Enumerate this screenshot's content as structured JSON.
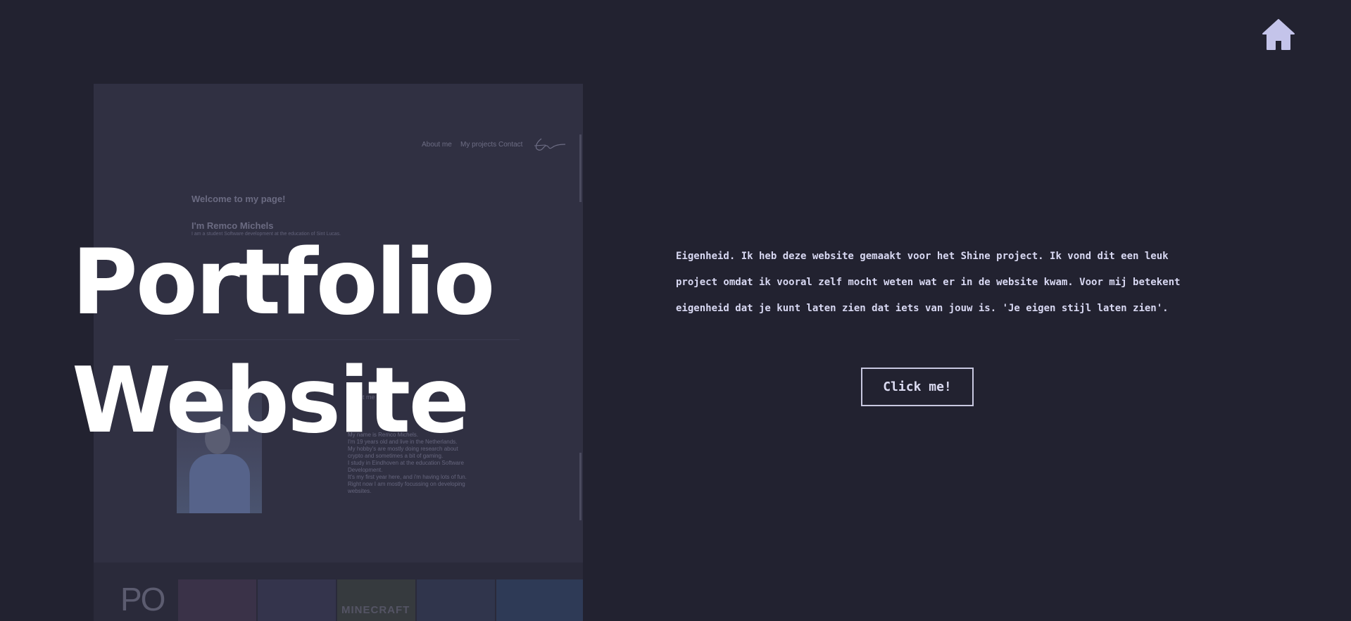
{
  "header": {
    "home_icon": "home-icon",
    "home_color": "#c4c4ea"
  },
  "hero": {
    "title_line1": "Portfolio",
    "title_line2": "Website"
  },
  "preview": {
    "nav_about": "About me",
    "nav_projects": "My projects",
    "nav_contact": "Contact",
    "welcome": "Welcome to my page!",
    "name": "I'm Remco Michels",
    "subtitle": "I am a student Software development at the education of Sint Lucas.",
    "about_title": "About me",
    "about_lines": [
      "My name is Remco Michels.",
      "I'm 19 years old and live in the Netherlands.",
      "My hobby's are mostly doing research about",
      "crypto and sometimes a bit of gaming.",
      "I study in Eindhoven at the education Software",
      "Development.",
      "It's my first year here, and i'm having lots of fun.",
      "Right now I am mostly focussing on developing",
      "websites."
    ],
    "logo": "PO",
    "tile_label": "MINECRAFT"
  },
  "content": {
    "description": "Eigenheid. Ik heb deze website gemaakt voor het Shine project. Ik vond dit een leuk project omdat ik vooral zelf mocht weten wat er in de website kwam. Voor mij betekent eigenheid dat je kunt laten zien dat iets van jouw is. 'Je eigen stijl laten zien'.",
    "button_label": "Click me!"
  },
  "colors": {
    "background": "#222230",
    "text": "#d8d8f2",
    "title": "#ffffff"
  }
}
